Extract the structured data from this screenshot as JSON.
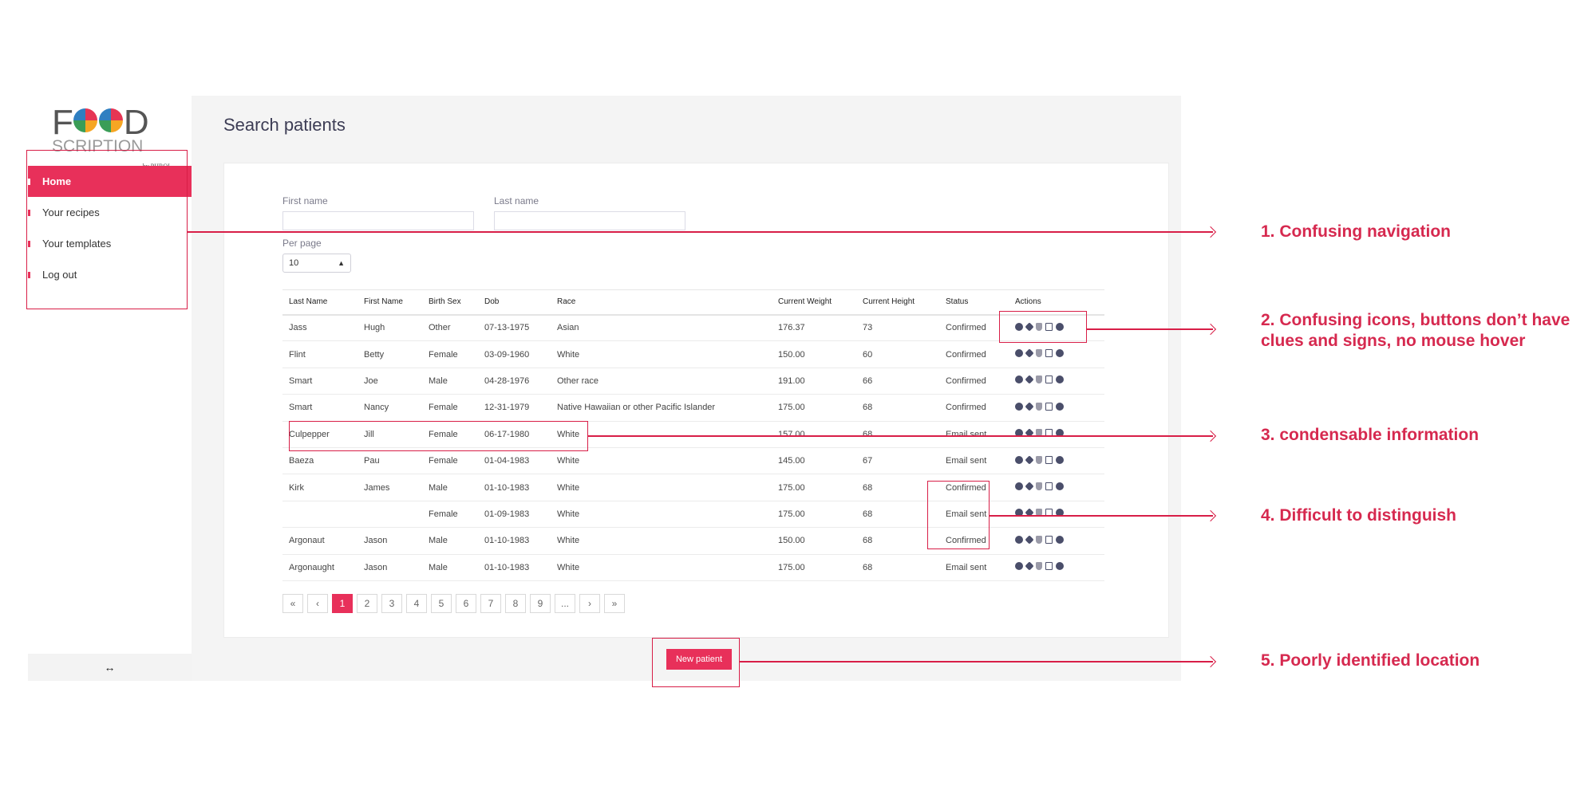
{
  "logo": {
    "word": "F  D",
    "sub": "SCRIPTION",
    "by": "by PHRQL"
  },
  "nav": {
    "items": [
      {
        "label": "Home",
        "active": true
      },
      {
        "label": "Your recipes"
      },
      {
        "label": "Your templates"
      },
      {
        "label": "Log out"
      }
    ]
  },
  "sidebar_footer": {
    "icon": "↔"
  },
  "page": {
    "title": "Search patients"
  },
  "filters": {
    "first_name_label": "First name",
    "first_name_value": "",
    "last_name_label": "Last name",
    "last_name_value": "",
    "per_page_label": "Per page",
    "per_page_value": "10"
  },
  "table": {
    "headers": [
      "Last Name",
      "First Name",
      "Birth Sex",
      "Dob",
      "Race",
      "Current Weight",
      "Current Height",
      "Status",
      "Actions"
    ],
    "rows": [
      [
        "Jass",
        "Hugh",
        "Other",
        "07-13-1975",
        "Asian",
        "176.37",
        "73",
        "Confirmed"
      ],
      [
        "Flint",
        "Betty",
        "Female",
        "03-09-1960",
        "White",
        "150.00",
        "60",
        "Confirmed"
      ],
      [
        "Smart",
        "Joe",
        "Male",
        "04-28-1976",
        "Other race",
        "191.00",
        "66",
        "Confirmed"
      ],
      [
        "Smart",
        "Nancy",
        "Female",
        "12-31-1979",
        "Native Hawaiian or other Pacific Islander",
        "175.00",
        "68",
        "Confirmed"
      ],
      [
        "Culpepper",
        "Jill",
        "Female",
        "06-17-1980",
        "White",
        "157.00",
        "68",
        "Email sent"
      ],
      [
        "Baeza",
        "Pau",
        "Female",
        "01-04-1983",
        "White",
        "145.00",
        "67",
        "Email sent"
      ],
      [
        "Kirk",
        "James",
        "Male",
        "01-10-1983",
        "White",
        "175.00",
        "68",
        "Confirmed"
      ],
      [
        "",
        "",
        "Female",
        "01-09-1983",
        "White",
        "175.00",
        "68",
        "Email sent"
      ],
      [
        "Argonaut",
        "Jason",
        "Male",
        "01-10-1983",
        "White",
        "150.00",
        "68",
        "Confirmed"
      ],
      [
        "Argonaught",
        "Jason",
        "Male",
        "01-10-1983",
        "White",
        "175.00",
        "68",
        "Email sent"
      ]
    ],
    "action_icons": [
      "user-circle-icon",
      "gear-icon",
      "food-icon",
      "calendar-icon",
      "plus-circle-icon"
    ]
  },
  "pagination": [
    "«",
    "‹",
    "1",
    "2",
    "3",
    "4",
    "5",
    "6",
    "7",
    "8",
    "9",
    "...",
    "›",
    "»"
  ],
  "pagination_active": "1",
  "new_patient_label": "New patient",
  "annotations": [
    {
      "label": "1. Confusing navigation"
    },
    {
      "label": "2. Confusing icons, buttons don’t have clues and signs, no mouse hover"
    },
    {
      "label": "3. condensable information"
    },
    {
      "label": "4. Difficult to distinguish"
    },
    {
      "label": "5. Poorly identified location"
    }
  ],
  "colors": {
    "accent": "#e8305a",
    "annotation": "#d6294f"
  }
}
